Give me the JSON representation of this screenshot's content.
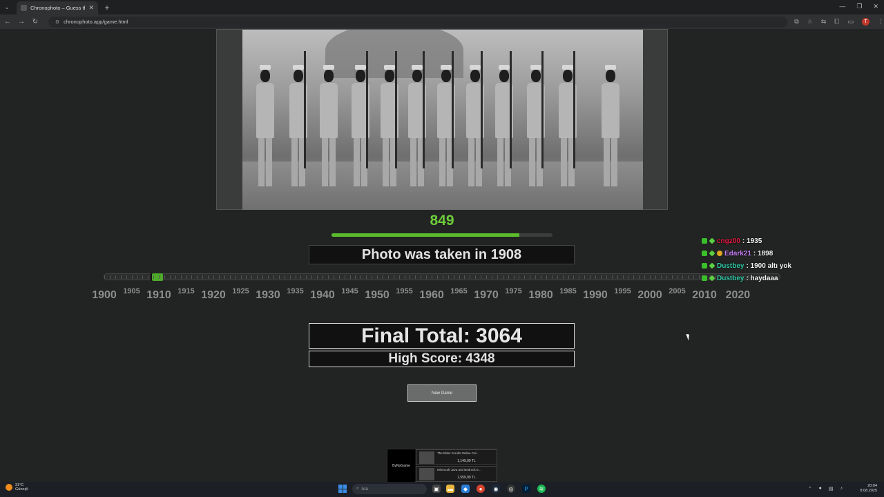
{
  "browser": {
    "tab_title": "Chronophoto – Guess the Year",
    "url": "chronophoto.app/game.html"
  },
  "game": {
    "round_score": "849",
    "round_score_fraction": 0.849,
    "taken_text": "Photo was taken in 1908",
    "guess_year": 1910,
    "actual_year": 1908,
    "final_total": "Final Total: 3064",
    "high_score": "High Score: 4348",
    "new_game_label": "New Game"
  },
  "timeline": {
    "min_year": 1900,
    "max_year": 2020,
    "labels": [
      "1900",
      "1905",
      "1910",
      "1915",
      "1920",
      "1925",
      "1930",
      "1935",
      "1940",
      "1945",
      "1950",
      "1955",
      "1960",
      "1965",
      "1970",
      "1975",
      "1980",
      "1985",
      "1990",
      "1995",
      "2000",
      "2005",
      "2010",
      "2020"
    ]
  },
  "chat": [
    {
      "name": "cngz00",
      "color": "#e0193f",
      "message": ": 1935",
      "badges": [
        "mod",
        "diamond"
      ]
    },
    {
      "name": "Edark21",
      "color": "#c27cf0",
      "message": ": 1898",
      "badges": [
        "mod",
        "diamond",
        "coin"
      ]
    },
    {
      "name": "Dustbey",
      "color": "#2fc8a6",
      "message": ": 1900 altı yok",
      "badges": [
        "mod",
        "diamond"
      ]
    },
    {
      "name": "Dustbey",
      "color": "#2fc8a6",
      "message": ": haydaaa",
      "badges": [
        "mod",
        "diamond"
      ]
    }
  ],
  "thumbnails": {
    "logo": "ByNoGame",
    "items": [
      {
        "title": "The Elder Scrolls Online Col...",
        "price": "1,149,99 TL"
      },
      {
        "title": "Minecraft Java and Bedrock E...",
        "price": "1,559,99 TL"
      }
    ]
  },
  "taskbar": {
    "weather_temp": "31°C",
    "weather_desc": "Güneşli",
    "search_placeholder": "Ara",
    "time": "20:04",
    "date": "8.08.2025"
  },
  "colors": {
    "accent_green": "#5bbd2b",
    "score_green": "#6ccd3a"
  }
}
